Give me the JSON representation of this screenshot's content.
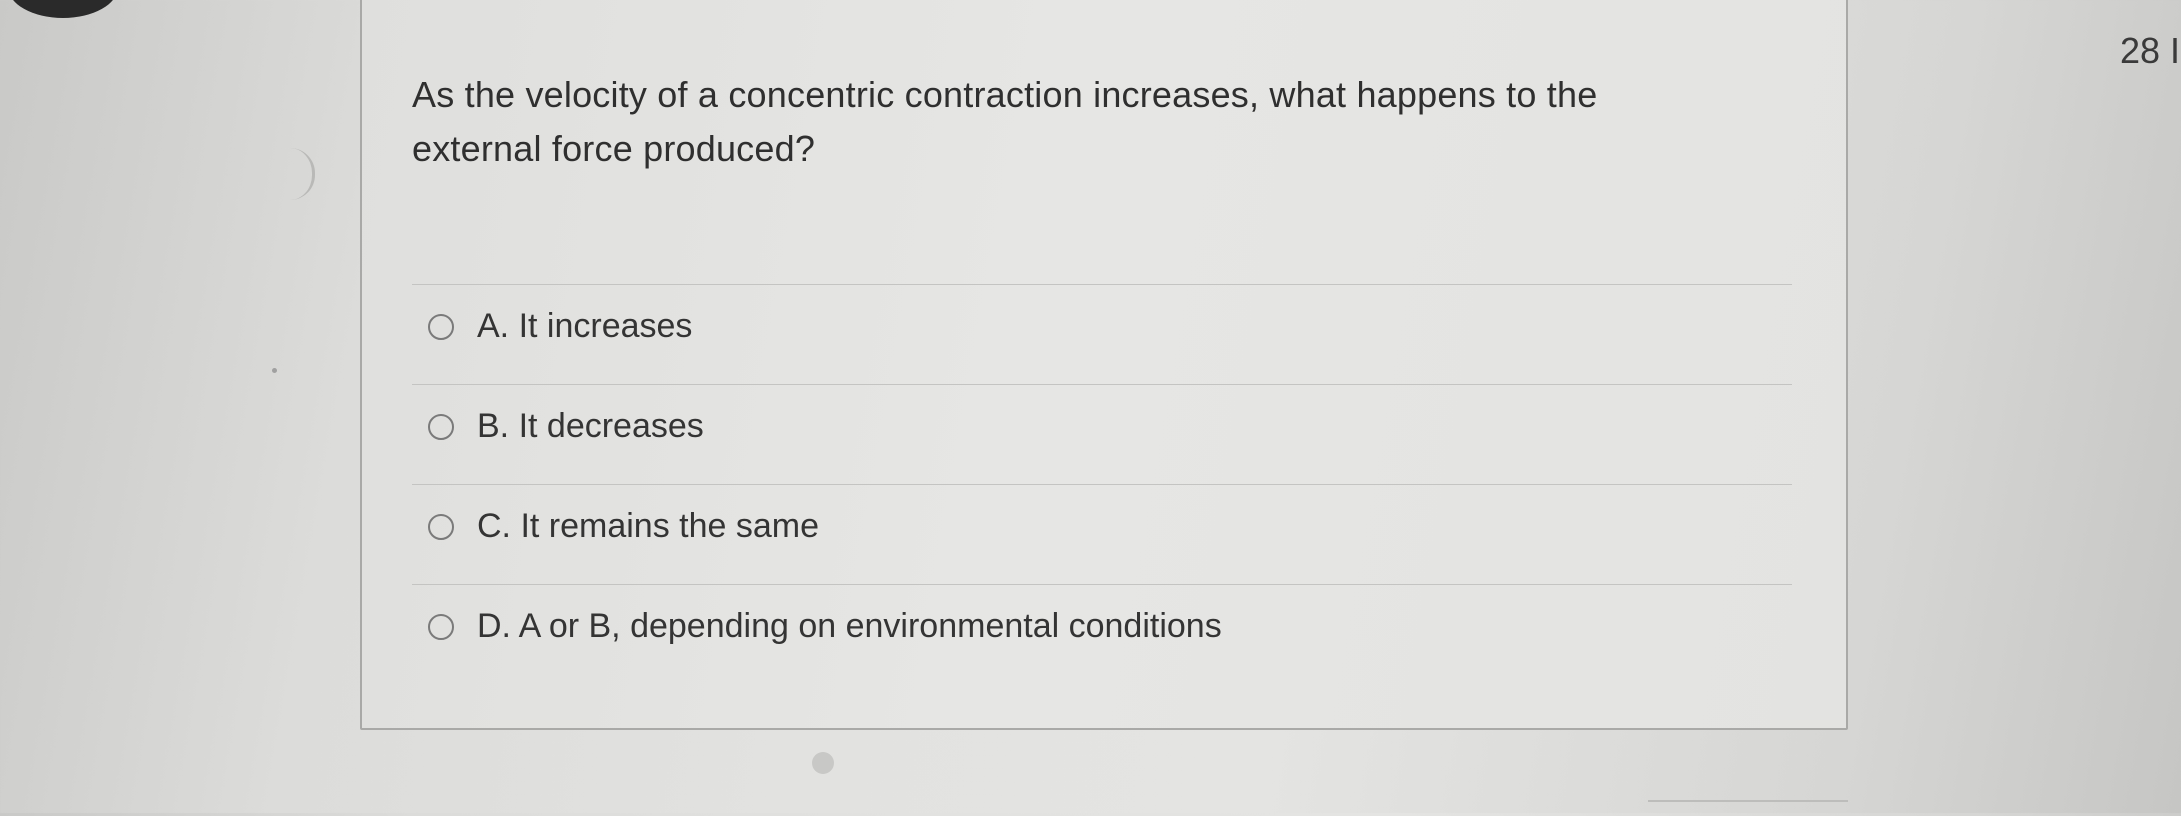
{
  "question": {
    "text": "As the velocity of a concentric contraction increases, what happens to the external force produced?"
  },
  "answers": [
    {
      "label": "A. It increases"
    },
    {
      "label": "B. It decreases"
    },
    {
      "label": "C. It remains the same"
    },
    {
      "label": "D. A or B, depending on environmental conditions"
    }
  ],
  "side_panel": {
    "counter_text": "28 I"
  },
  "colors": {
    "background": "#e2e2e0",
    "card_border": "#a9a9a7",
    "text": "#2f2f2f",
    "radio_border": "#7a7a7a"
  }
}
